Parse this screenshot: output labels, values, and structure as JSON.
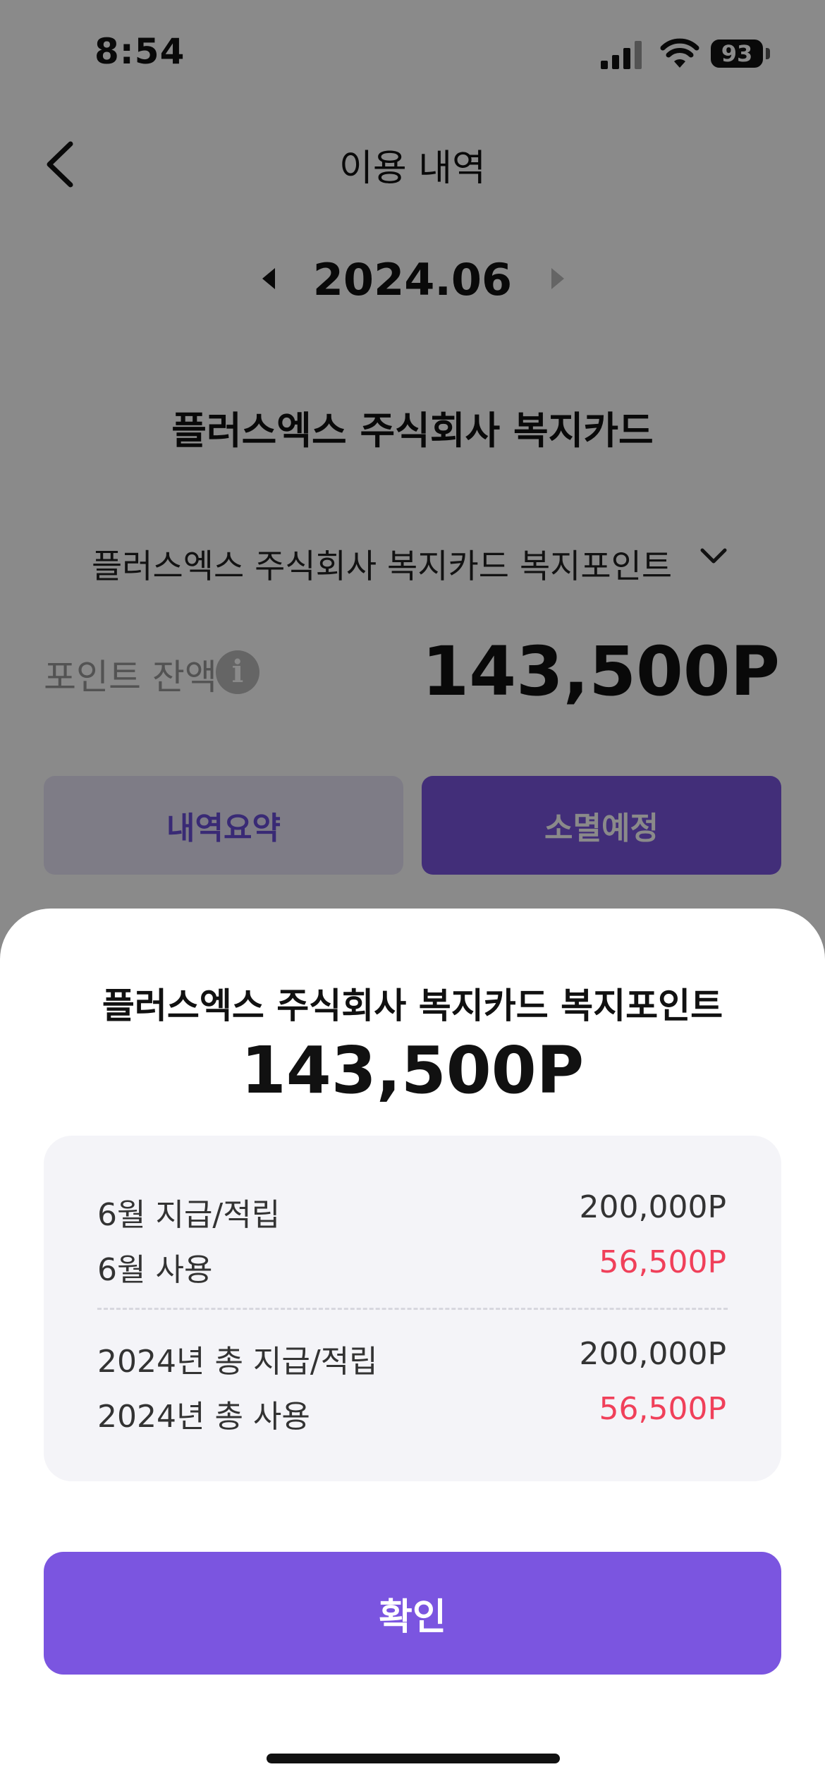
{
  "status_bar": {
    "time": "8:54",
    "battery": "93"
  },
  "header": {
    "title": "이용 내역"
  },
  "month_nav": {
    "month": "2024.06"
  },
  "card": {
    "name": "플러스엑스 주식회사 복지카드"
  },
  "point_selector": {
    "selected": "플러스엑스 주식회사 복지카드 복지포인트"
  },
  "balance": {
    "label": "포인트 잔액",
    "value": "143,500P"
  },
  "tabs": {
    "summary": "내역요약",
    "expire": "소멸예정"
  },
  "sheet": {
    "title": "플러스엑스 주식회사 복지카드 복지포인트",
    "amount": "143,500P",
    "rows": [
      {
        "label": "6월 지급/적립",
        "value": "200,000P"
      },
      {
        "label": "6월 사용",
        "value": "56,500P"
      },
      {
        "label": "2024년 총 지급/적립",
        "value": "200,000P"
      },
      {
        "label": "2024년 총 사용",
        "value": "56,500P"
      }
    ],
    "confirm": "확인"
  },
  "colors": {
    "accent": "#7b55e0",
    "usage_red": "#f0405a"
  },
  "icons": {
    "back": "chevron-left-icon",
    "prev": "triangle-left-icon",
    "next": "triangle-right-icon",
    "dropdown": "chevron-down-icon",
    "info": "info-icon"
  }
}
